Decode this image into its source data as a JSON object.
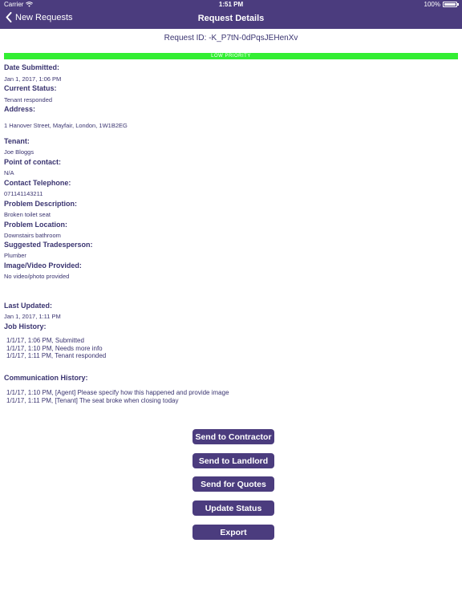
{
  "status_bar": {
    "carrier": "Carrier",
    "time": "1:51 PM",
    "battery": "100%"
  },
  "nav": {
    "back_label": "New Requests",
    "title": "Request Details"
  },
  "request": {
    "id_text": "Request ID: -K_P7tN-0dPqsJEHenXv",
    "priority": "LOW PRIORITY"
  },
  "fields": {
    "date_submitted": {
      "label": "Date Submitted:",
      "value": "Jan 1, 2017, 1:06 PM"
    },
    "current_status": {
      "label": "Current Status:",
      "value": "Tenant responded"
    },
    "address": {
      "label": "Address:",
      "value": "1 Hanover Street, Mayfair, London, 1W1B2EG"
    },
    "tenant": {
      "label": "Tenant:",
      "value": "Joe Bloggs"
    },
    "point_of_contact": {
      "label": "Point of contact:",
      "value": "N/A"
    },
    "contact_telephone": {
      "label": "Contact Telephone:",
      "value": "071141143211"
    },
    "problem_description": {
      "label": "Problem Description:",
      "value": "Broken toilet seat"
    },
    "problem_location": {
      "label": "Problem Location:",
      "value": "Downstairs bathroom"
    },
    "suggested_tradesperson": {
      "label": "Suggested Tradesperson:",
      "value": "Plumber"
    },
    "image_video": {
      "label": "Image/Video Provided:",
      "value": "No video/photo provided"
    },
    "last_updated": {
      "label": "Last Updated:",
      "value": "Jan 1, 2017, 1:11 PM"
    }
  },
  "job_history": {
    "label": "Job History:",
    "entries": [
      "1/1/17, 1:06 PM, Submitted",
      "1/1/17, 1:10 PM, Needs more info",
      "1/1/17, 1:11 PM, Tenant responded"
    ]
  },
  "communication_history": {
    "label": "Communication History:",
    "entries": [
      "1/1/17, 1:10 PM, [Agent] Please specify how this happened and provide image",
      "1/1/17, 1:11 PM, [Tenant] The seat broke when closing today"
    ]
  },
  "actions": {
    "send_to_contractor": "Send to Contractor",
    "send_to_landlord": "Send to Landlord",
    "send_for_quotes": "Send for Quotes",
    "update_status": "Update Status",
    "export": "Export"
  },
  "colors": {
    "header": "#4b3c7e",
    "text": "#3a3470",
    "priority_low": "#33ee33"
  },
  "icons": {
    "back": "chevron-left-icon",
    "wifi": "wifi-icon",
    "battery": "battery-icon"
  }
}
